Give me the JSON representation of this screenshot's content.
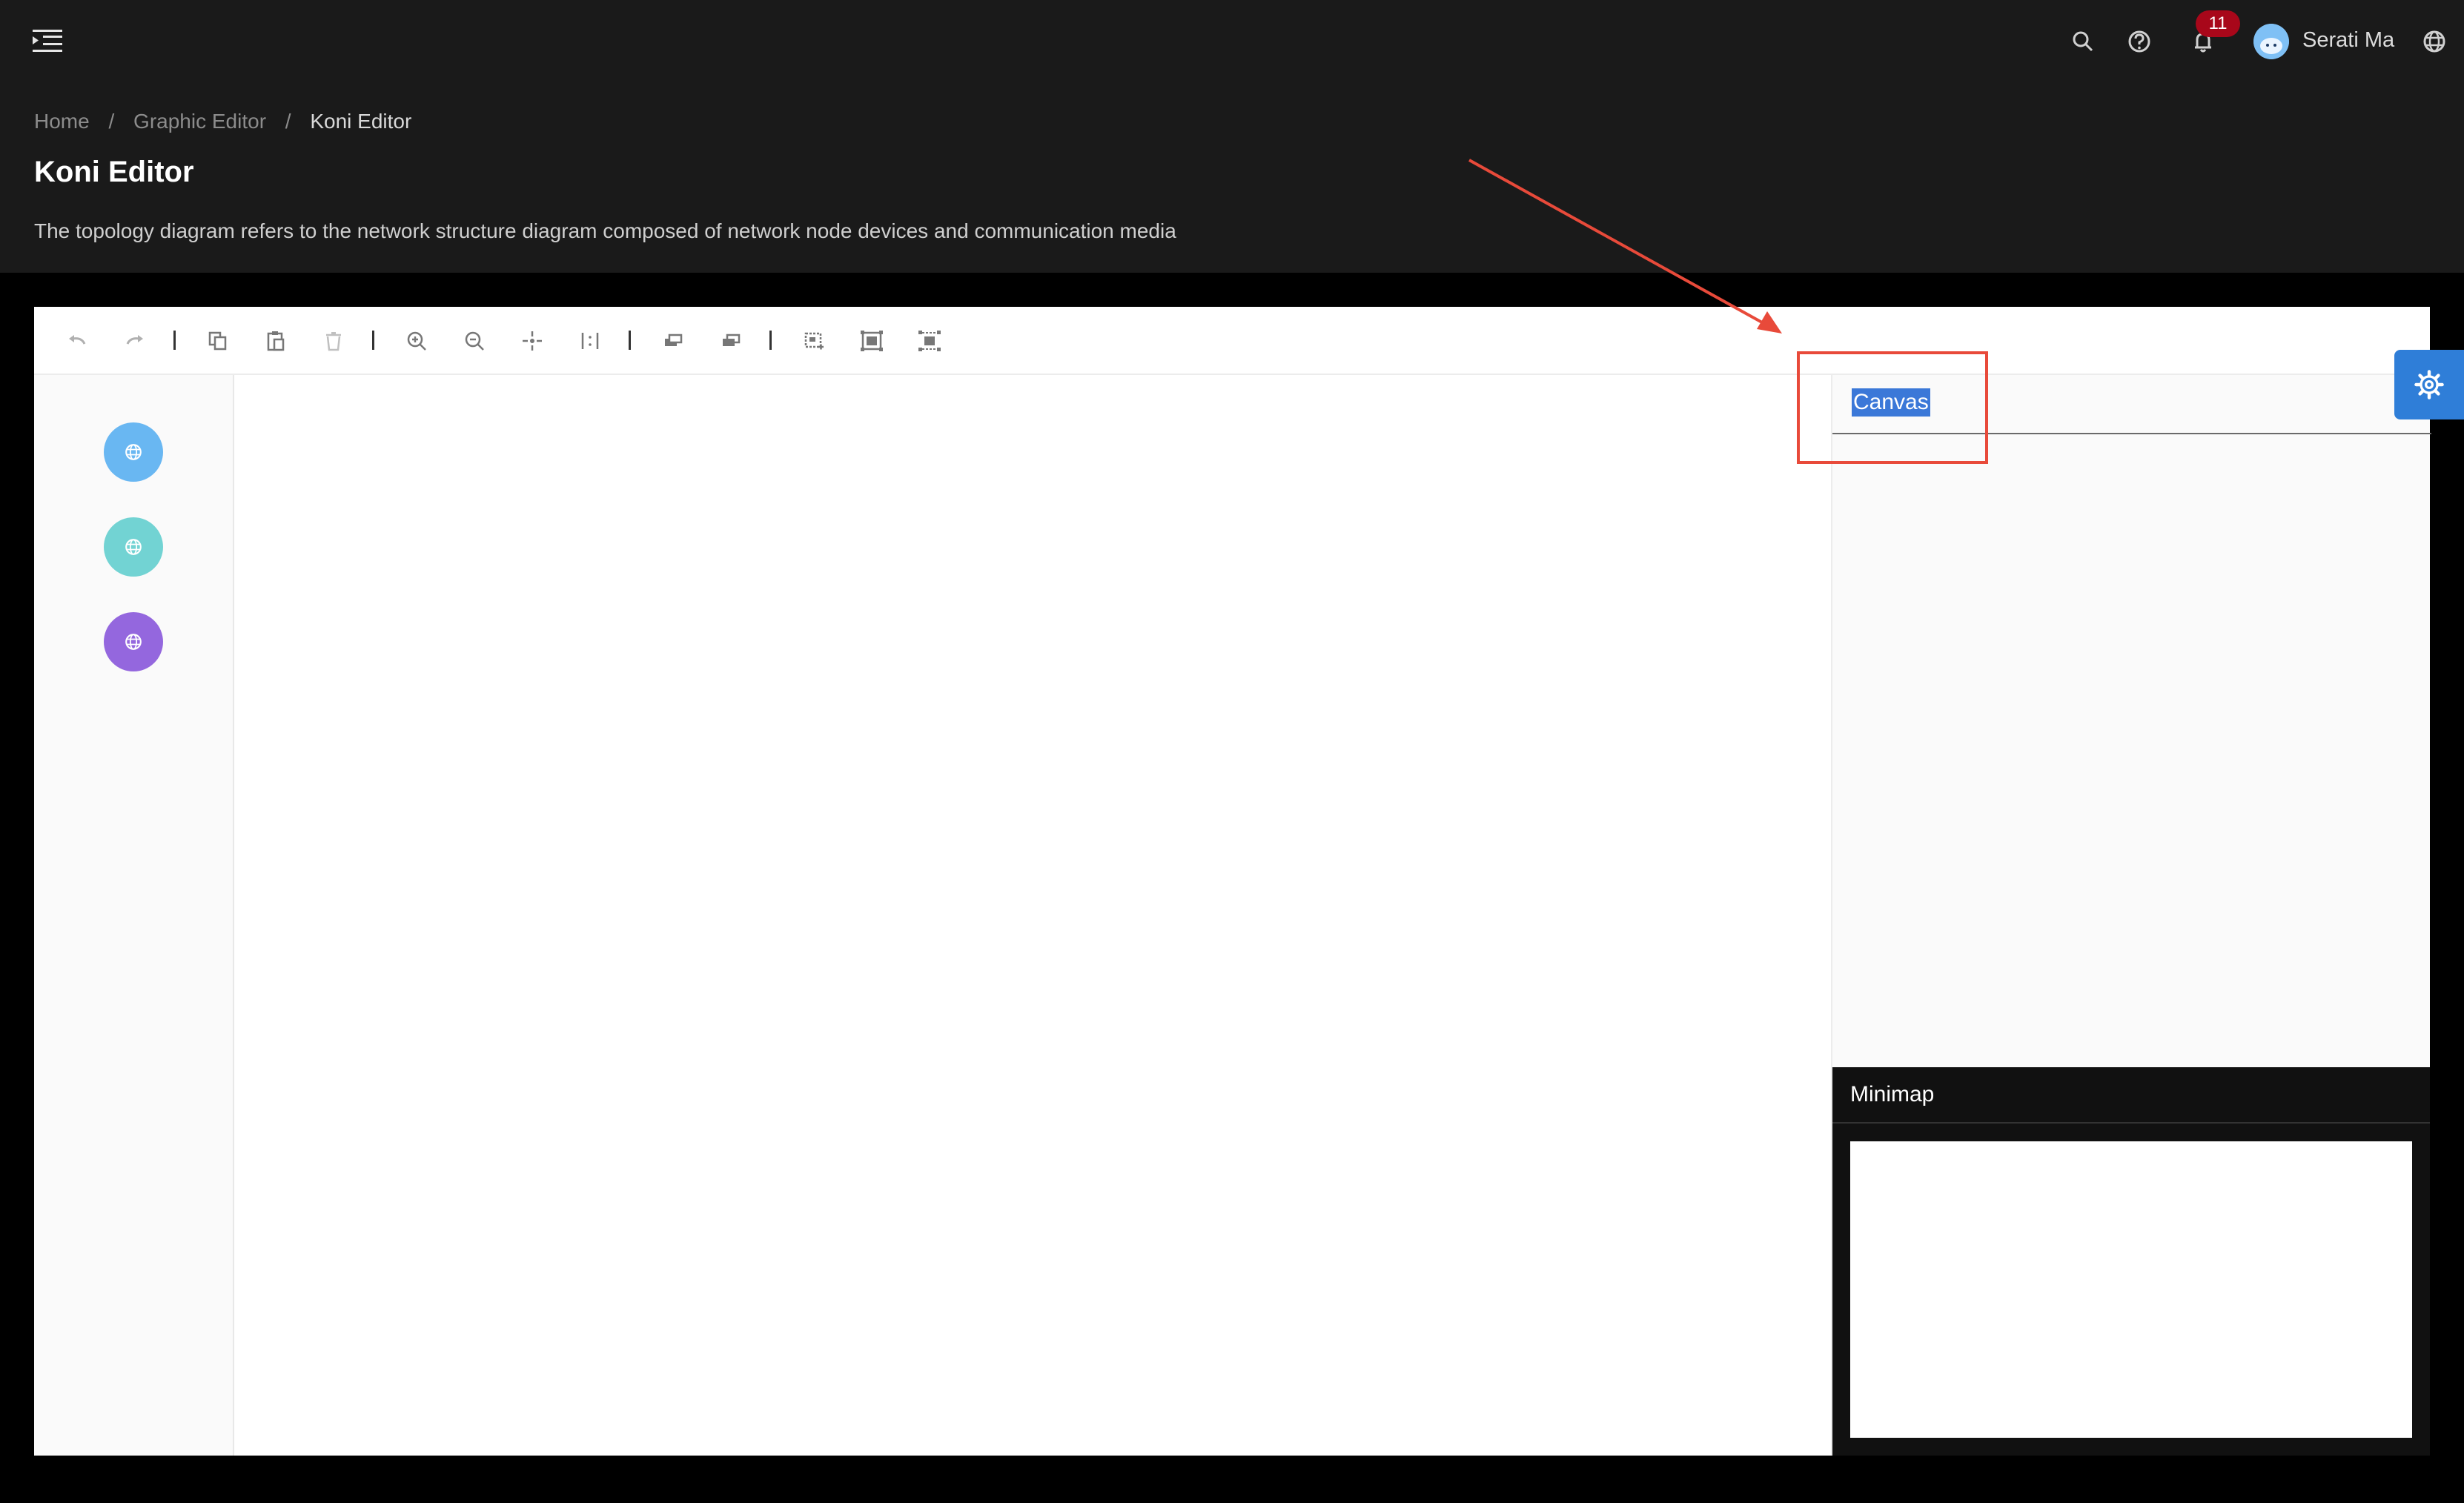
{
  "header": {
    "notification_count": "11",
    "user_name": "Serati Ma",
    "icons": [
      "menu-fold-icon",
      "search-icon",
      "question-icon",
      "bell-icon",
      "globe-icon"
    ]
  },
  "breadcrumb": {
    "items": [
      "Home",
      "Graphic Editor",
      "Koni Editor"
    ],
    "separator": "/"
  },
  "page": {
    "title": "Koni Editor",
    "description": "The topology diagram refers to the network structure diagram composed of network node devices and communication media"
  },
  "toolbar": {
    "buttons": [
      "undo",
      "redo",
      "copy",
      "paste",
      "delete",
      "zoom-in",
      "zoom-out",
      "auto-zoom",
      "reset-zoom",
      "to-back",
      "to-front",
      "multi-select",
      "add-group",
      "ungroup"
    ]
  },
  "item_panel": {
    "nodes": [
      {
        "icon": "globe-icon",
        "color": "#69b7f2"
      },
      {
        "icon": "globe-icon",
        "color": "#72d3d3"
      },
      {
        "icon": "globe-icon",
        "color": "#9467de"
      }
    ]
  },
  "detail_panel": {
    "title": "Canvas"
  },
  "minimap": {
    "title": "Minimap"
  },
  "colors": {
    "accent": "#2f7ed8",
    "badge": "#a8071a",
    "annotation": "#e84a3a"
  }
}
